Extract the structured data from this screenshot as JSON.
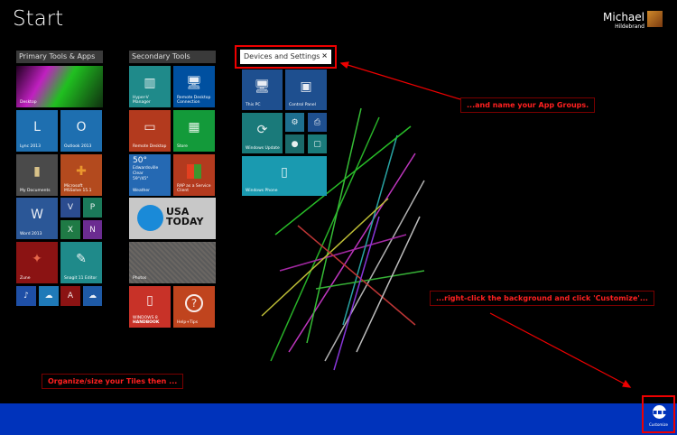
{
  "header": {
    "title": "Start",
    "user_first": "Michael",
    "user_last": "Hildebrand"
  },
  "groups": [
    {
      "name": "Primary Tools & Apps",
      "tiles": [
        "Desktop",
        "Lync 2013",
        "Outlook 2013",
        "My Documents",
        "Microsoft MSSolve 15.1",
        "Word 2013",
        "Zune",
        "Snagit 11 Editor"
      ]
    },
    {
      "name": "Secondary Tools",
      "tiles": [
        "Hyper-V Manager",
        "Remote Desktop Connection",
        "Remote Desktop",
        "Store",
        "Weather",
        "RAP as a Service Client",
        "Photos",
        "Help+Tips"
      ]
    },
    {
      "name": "Devices and Settings",
      "tiles": [
        "This PC",
        "Control Panel",
        "Windows Update",
        "Windows Phone"
      ]
    }
  ],
  "weather": {
    "temp": "50°",
    "city": "Edwardsville",
    "cond": "Clear",
    "range": "59°/45°"
  },
  "usa_today": {
    "line1": "USA",
    "line2": "TODAY"
  },
  "handbook": {
    "line1": "WINDOWS 8",
    "line2": "HANDBOOK"
  },
  "annotations": {
    "name_groups": "...and name your App Groups.",
    "right_click": "...right-click the background and click 'Customize'...",
    "organize": "Organize/size your Tiles then ..."
  },
  "appbar": {
    "customize": "Customize"
  },
  "colors": {
    "appbar": "#0033bb",
    "annotation": "#ff2020"
  }
}
